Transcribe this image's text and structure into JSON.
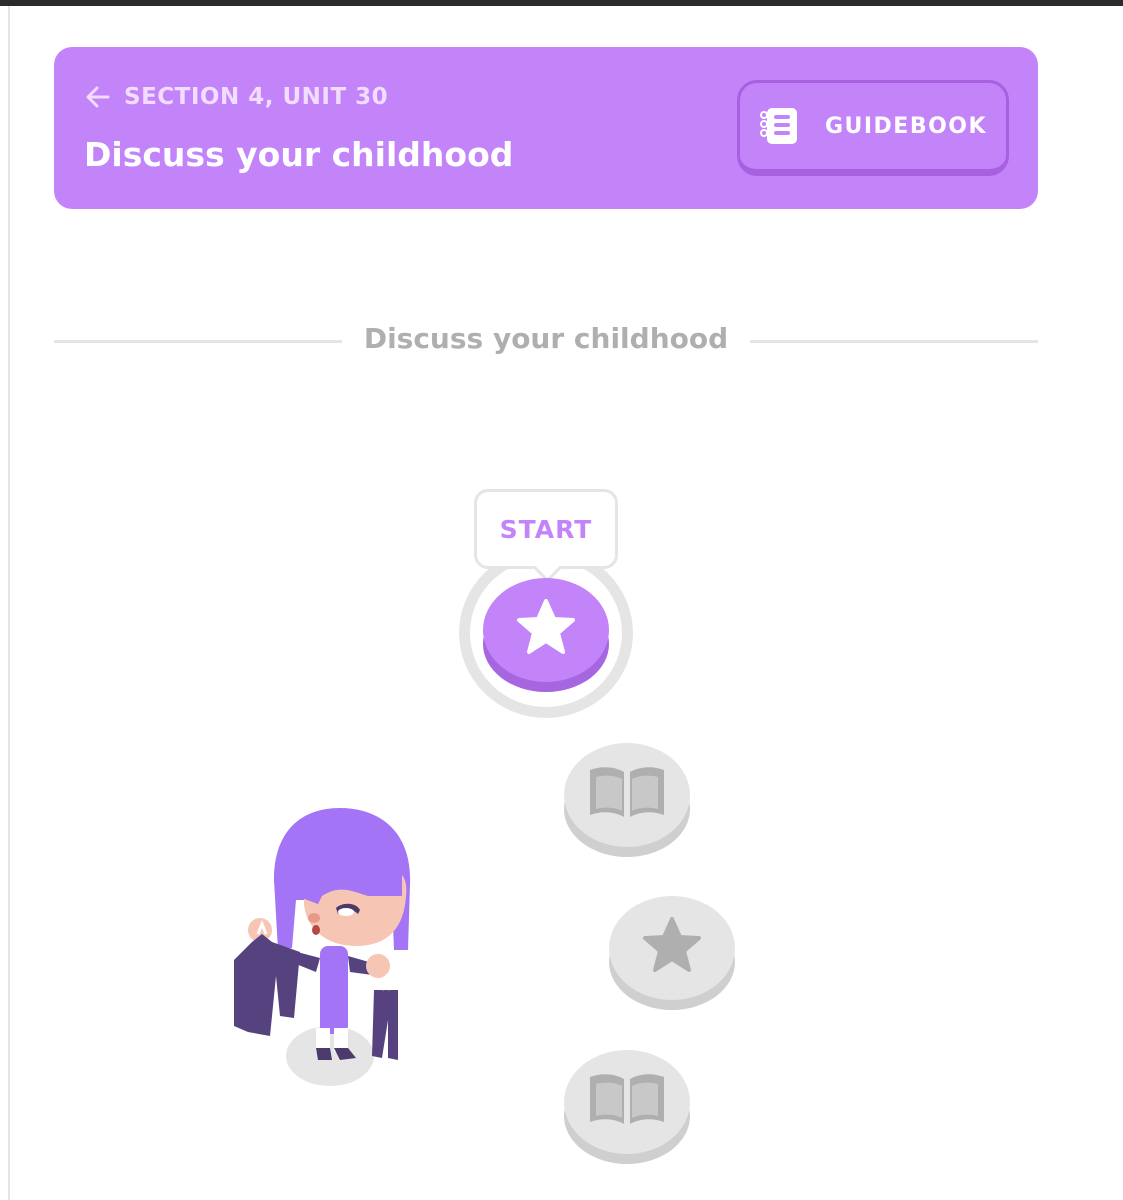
{
  "header": {
    "section_label": "SECTION 4, UNIT 30",
    "title": "Discuss your childhood",
    "guidebook_label": "GUIDEBOOK",
    "color": "#c384f9",
    "back_icon": "arrow-left-icon",
    "guidebook_icon": "notebook-icon"
  },
  "divider": {
    "label": "Discuss your childhood"
  },
  "path": {
    "tooltip_label": "START",
    "nodes": [
      {
        "type": "star",
        "state": "active",
        "icon": "star-icon",
        "color": "#c384f9"
      },
      {
        "type": "book",
        "state": "locked",
        "icon": "book-icon",
        "color": "#e5e5e5"
      },
      {
        "type": "star",
        "state": "locked",
        "icon": "star-icon",
        "color": "#e5e5e5"
      },
      {
        "type": "book",
        "state": "locked",
        "icon": "book-icon",
        "color": "#e5e5e5"
      }
    ]
  },
  "illustration": {
    "character": "purple-haired girl holding clothes"
  }
}
